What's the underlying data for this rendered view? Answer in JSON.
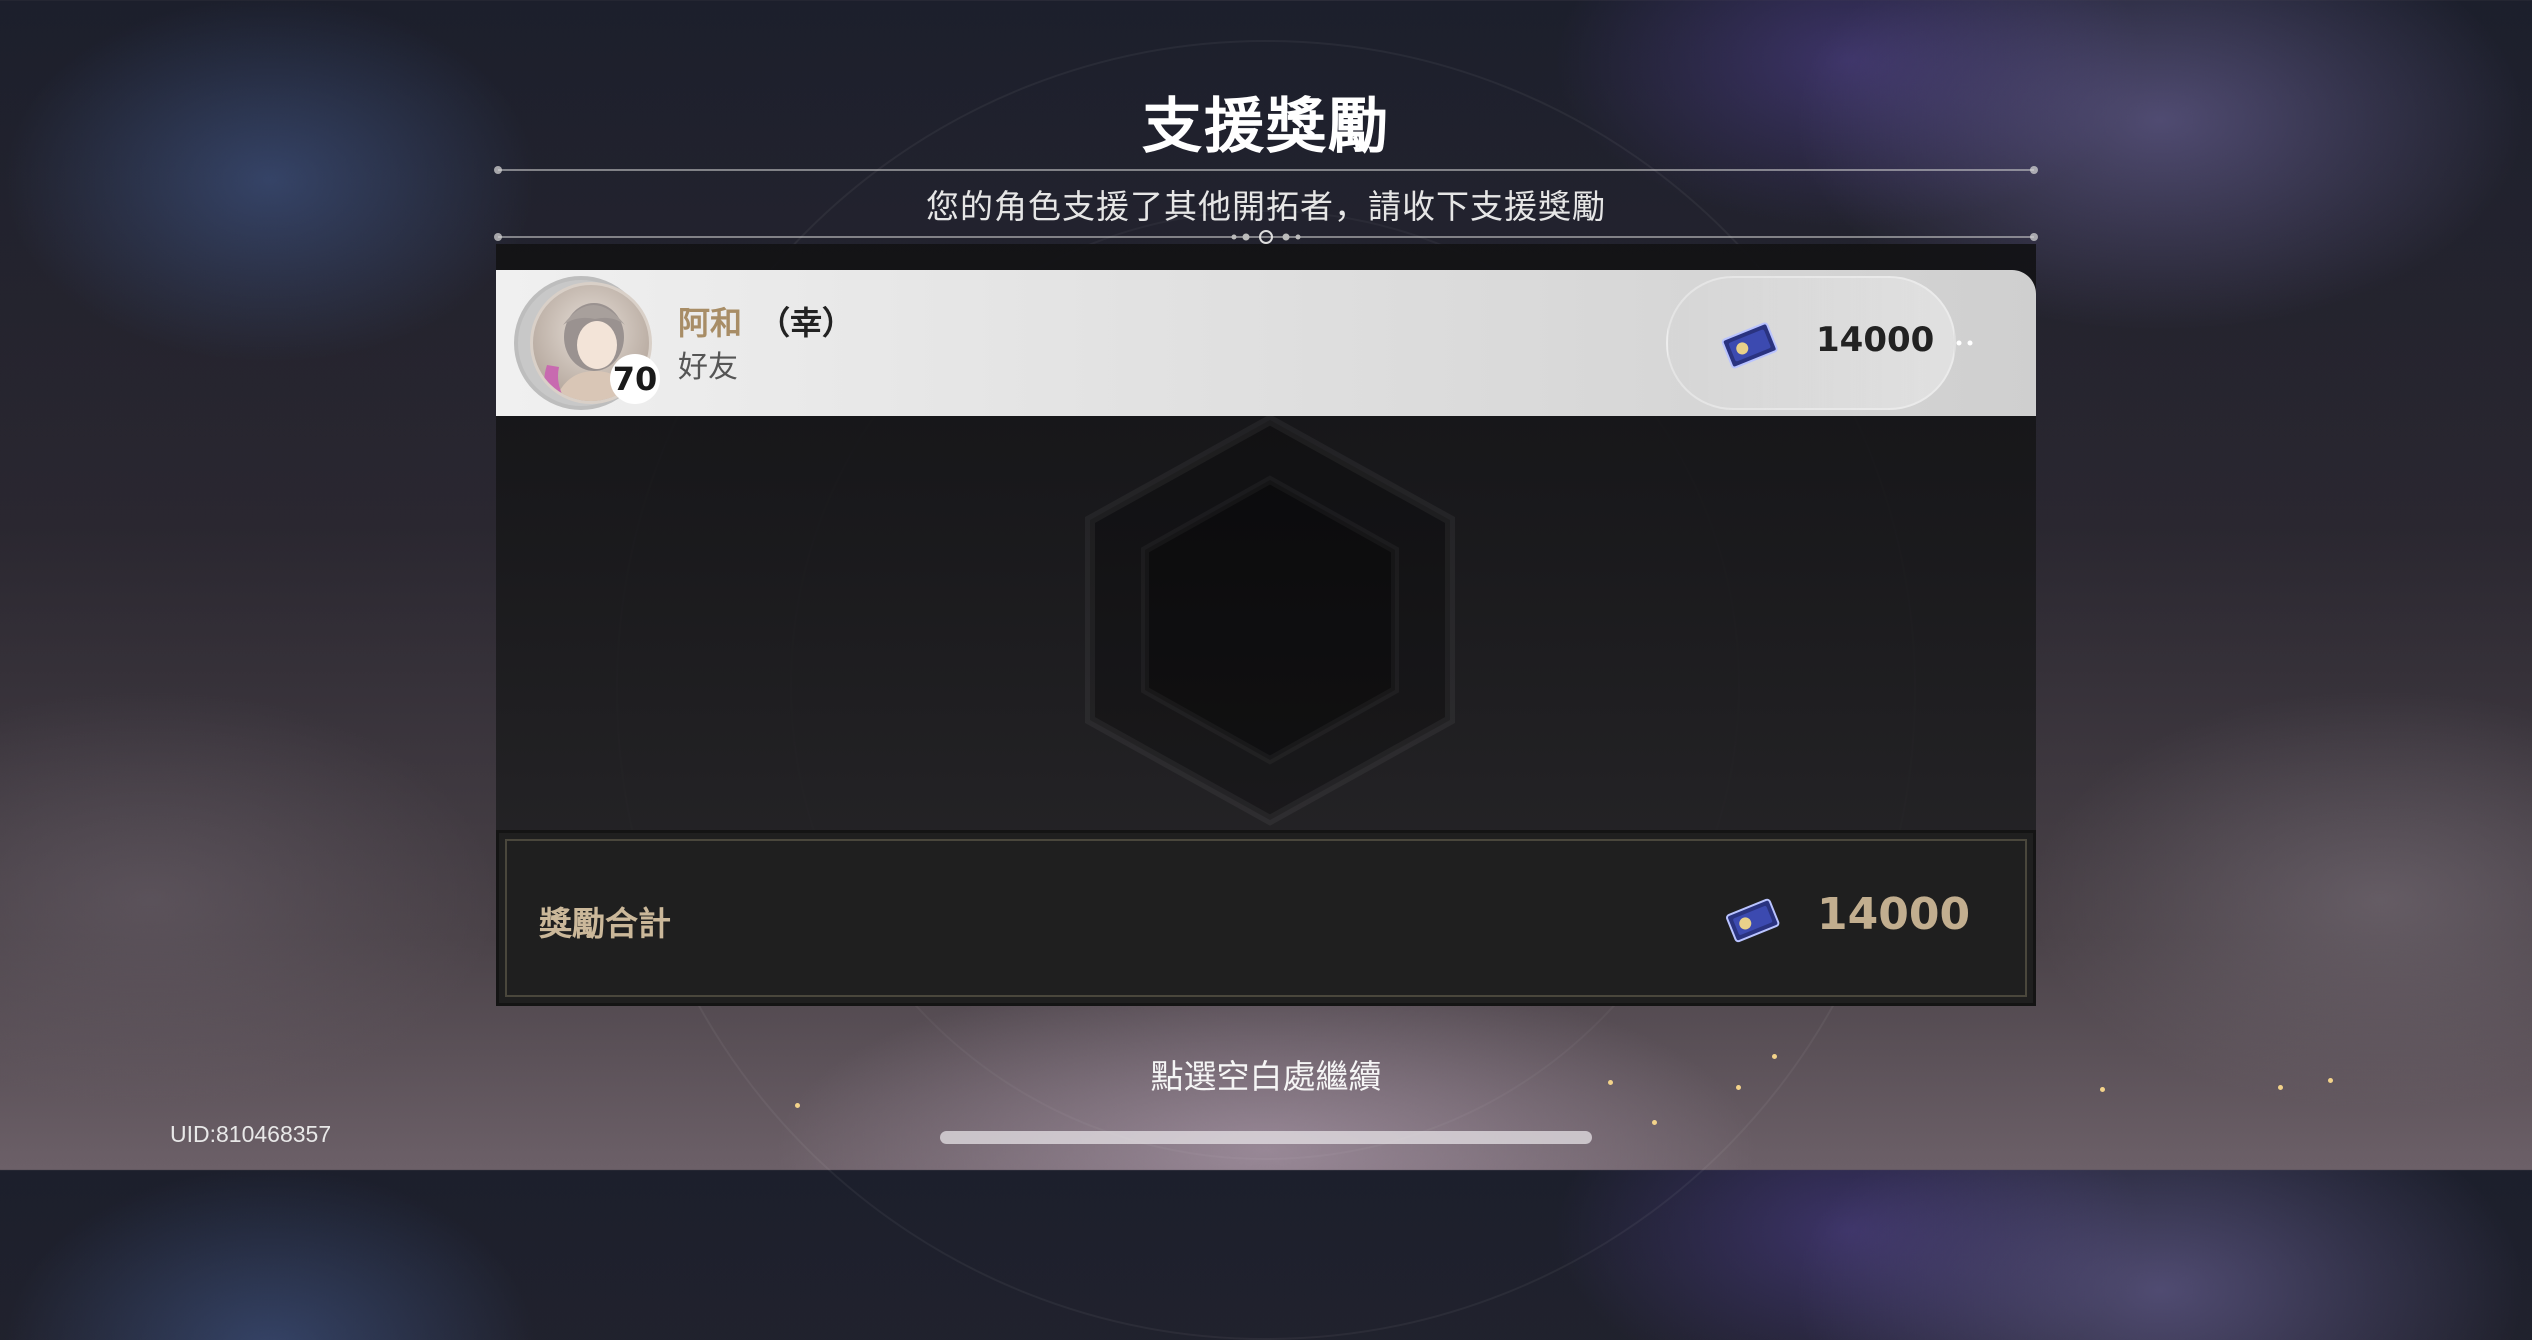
{
  "dialog": {
    "title": "支援獎勵",
    "subtitle": "您的角色支援了其他開拓者，請收下支援獎勵"
  },
  "entries": [
    {
      "name": "阿和",
      "character": "（幸）",
      "relation": "好友",
      "level": "70",
      "reward_icon": "star-rail-pass-icon",
      "reward_amount": "14000"
    }
  ],
  "total": {
    "label": "獎勵合計",
    "reward_icon": "star-rail-pass-icon",
    "amount": "14000"
  },
  "footer": {
    "continue_hint": "點選空白處繼續",
    "uid": "UID:810468357"
  },
  "colors": {
    "accent_gold": "#a88d66",
    "total_amount": "#c2ae8f",
    "panel_bg": "#1f1f1f"
  }
}
